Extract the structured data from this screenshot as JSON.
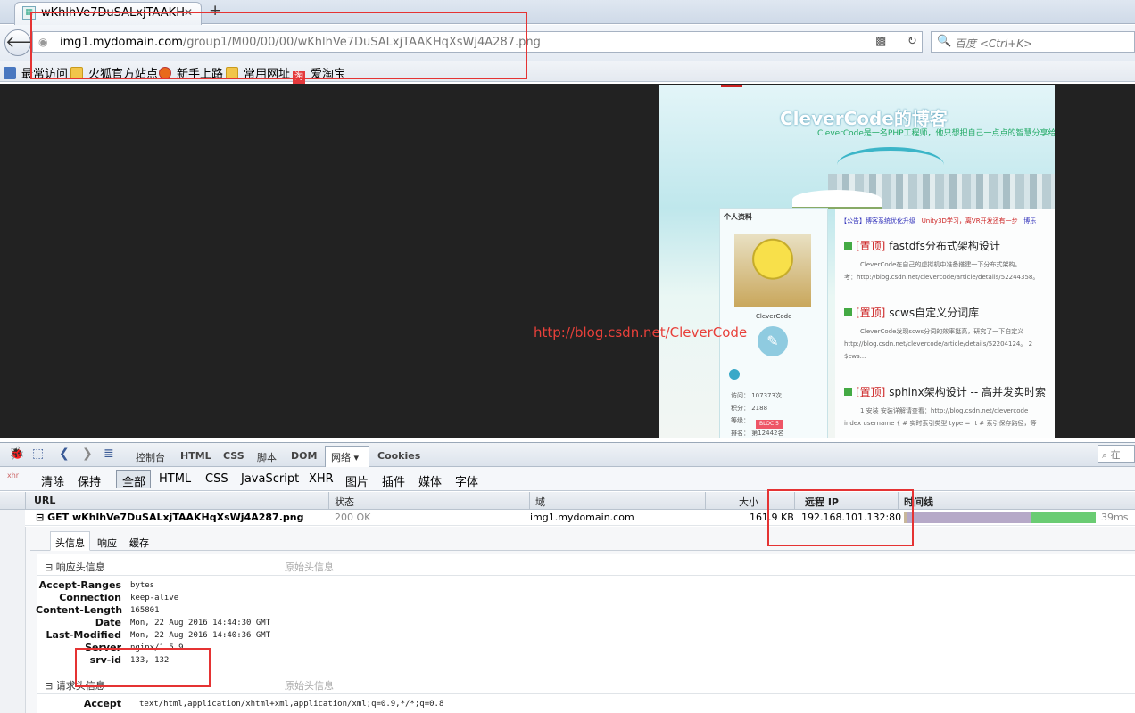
{
  "browser": {
    "tab_title": "wKhlhVe7DuSALxjTAAKH",
    "new_tab": "+",
    "url_host": "img1.mydomain.com",
    "url_path": "/group1/M00/00/00/wKhlhVe7DuSALxjTAAKHqXsWj4A287.png",
    "search_placeholder": "百度 <Ctrl+K>",
    "bookmarks": [
      "最常访问",
      "火狐官方站点",
      "新手上路",
      "常用网址",
      "爱淘宝"
    ],
    "taobao_icon": "淘"
  },
  "page_image": {
    "blog_title": "CleverCode的博客",
    "blog_subtitle": "CleverCode是一名PHP工程师，他只想把自己一点点的智慧分享给",
    "sidebar_heading": "个人资料",
    "username": "CleverCode",
    "stats": [
      "访问：  107373次",
      "积分：  2188",
      "等级：",
      "排名：  第12442名"
    ],
    "level_badge": "BLOC 5",
    "notice": "【公告】博客系统优化升级",
    "notice2": "Unity3D学习，离VR开发还有一步",
    "notice3": "博乐",
    "posts": [
      {
        "tag": "[置顶]",
        "title": "fastdfs分布式架构设计",
        "desc1": "CleverCode在自己的虚拟机中准备搭建一下分布式架构。",
        "desc2": "考：http://blog.csdn.net/clevercode/article/details/52244358。"
      },
      {
        "tag": "[置顶]",
        "title": "scws自定义分词库",
        "desc1": "CleverCode发现scws分词的效率挺高，研究了一下自定义",
        "desc2": "http://blog.csdn.net/clevercode/article/details/52204124。 2 ",
        "desc3": "$cws..."
      },
      {
        "tag": "[置顶]",
        "title": "sphinx架构设计 -- 高并发实时索",
        "desc1": "1 安装   安装详解请查看：http://blog.csdn.net/clevercode",
        "desc2": "index username { # 实时索引类型 type = rt # 索引保存路径，等"
      }
    ],
    "watermark": "http://blog.csdn.net/CleverCode"
  },
  "firebug": {
    "tabs": [
      "控制台",
      "HTML",
      "CSS",
      "脚本",
      "DOM",
      "网络 ▾",
      "Cookies"
    ],
    "search_placeholder": "在",
    "filters": [
      "清除",
      "保持",
      "全部",
      "HTML",
      "CSS",
      "JavaScript",
      "XHR",
      "图片",
      "插件",
      "媒体",
      "字体"
    ],
    "xhr_icon": "xhr",
    "columns": [
      "URL",
      "状态",
      "域",
      "大小",
      "远程 IP",
      "时间线"
    ],
    "request": {
      "toggle": "⊟",
      "label": "GET wKhlhVe7DuSALxjTAAKHqXsWj4A287.png",
      "status": "200 OK",
      "domain": "img1.mydomain.com",
      "size": "161.9 KB",
      "remote_ip": "192.168.101.132:80",
      "time": "39ms"
    },
    "subtabs": [
      "头信息",
      "响应",
      "缓存"
    ],
    "response_section": "⊟ 响应头信息",
    "request_section": "⊟ 请求头信息",
    "raw_link": "原始头信息",
    "response_headers": [
      {
        "k": "Accept-Ranges",
        "v": "bytes"
      },
      {
        "k": "Connection",
        "v": "keep-alive"
      },
      {
        "k": "Content-Length",
        "v": "165801"
      },
      {
        "k": "Date",
        "v": "Mon, 22 Aug 2016 14:44:30 GMT"
      },
      {
        "k": "Last-Modified",
        "v": "Mon, 22 Aug 2016 14:40:36 GMT"
      },
      {
        "k": "Server",
        "v": "nginx/1.5.9"
      },
      {
        "k": "srv-id",
        "v": "133, 132"
      }
    ],
    "request_headers": [
      {
        "k": "Accept",
        "v": "text/html,application/xhtml+xml,application/xml;q=0.9,*/*;q=0.8"
      }
    ]
  }
}
